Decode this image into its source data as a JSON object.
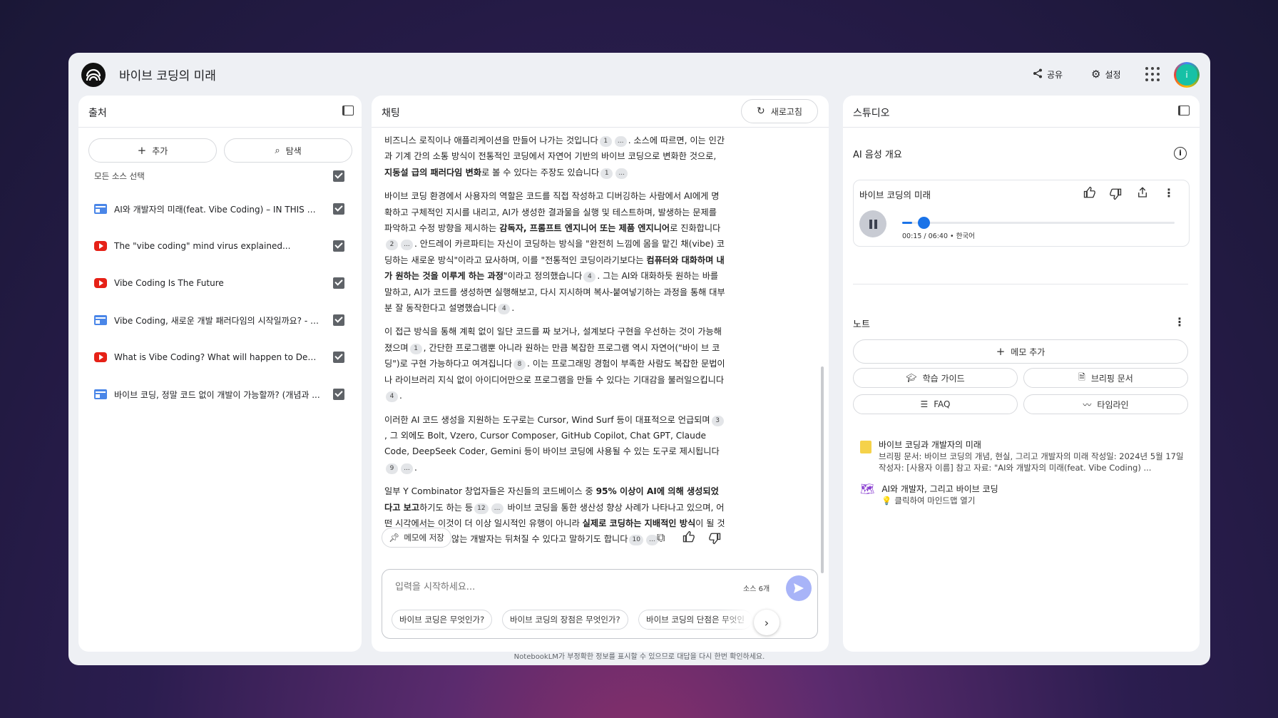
{
  "header": {
    "title": "바이브 코딩의 미래",
    "share": "공유",
    "settings": "설정",
    "avatar_initial": "i"
  },
  "sources": {
    "title": "출처",
    "add": "추가",
    "explore": "탐색",
    "select_all": "모든 소스 선택",
    "items": [
      {
        "label": "AI와 개발자의 미래(feat. Vibe Coding) – IN THIS W...",
        "type": "doc"
      },
      {
        "label": "The \"vibe coding\" mind virus explained...",
        "type": "youtube"
      },
      {
        "label": "Vibe Coding Is The Future",
        "type": "youtube"
      },
      {
        "label": "Vibe Coding, 새로운 개발 패러다임의 시작일까요? - t...",
        "type": "doc"
      },
      {
        "label": "What is Vibe Coding? What will happen to Devel...",
        "type": "youtube"
      },
      {
        "label": "바이브 코딩, 정말 코드 없이 개발이 가능할까? (개념과 ...",
        "type": "doc"
      }
    ]
  },
  "chat": {
    "title": "채팅",
    "refresh": "새로고침",
    "p1": {
      "a": "비즈니스 로직이나 애플리케이션을 만들어 나가는 것입니다",
      "c1": "1",
      "c2": "...",
      "b": ". 소스에 따르면, 이는 인간과 기계 간의 소통 방식이 전통적인 코딩에서 자연어 기반의 바이브 코딩으로 변화한 것으로, ",
      "bold": "지동설 급의 패러다임 변화",
      "d": "로 볼 수 있다는 주장도 있습니다",
      "c3": "1",
      "c4": "..."
    },
    "p2": {
      "a": "바이브 코딩 환경에서 사용자의 역할은 코드를 직접 작성하고 디버깅하는 사람에서 AI에게 명확하고 구체적인 지시를 내리고, AI가 생성한 결과물을 실행 및 테스트하며, 발생하는 문제를 파악하고 수정 방향을 제시하는 ",
      "bold1": "감독자, 프롬프트 엔지니어 또는 제품 엔지니어",
      "b": "로 진화합니다",
      "c1": "2",
      "c2": "...",
      "c": ". 안드레이 카르파티는 자신이 코딩하는 방식을 \"완전히 느낌에 몸을 맡긴 채(vibe) 코딩하는 새로운 방식\"이라고 묘사하며, 이를 \"전통적인 코딩이라기보다는 ",
      "bold2": "컴퓨터와 대화하며 내가 원하는 것을 이루게 하는 과정",
      "d": "\"이라고 정의했습니다",
      "c3": "4",
      "e": ". 그는 AI와 대화하듯 원하는 바를 말하고, AI가 코드를 생성하면 실행해보고, 다시 지시하며 복사-붙여넣기하는 과정을 통해 대부분 잘 동작한다고 설명했습니다",
      "c4": "4"
    },
    "p3": {
      "a": "이 접근 방식을 통해 계획 없이 일단 코드를 짜 보거나, 설계보다 구현을 우선하는 것이 가능해졌으며",
      "c1": "1",
      "b": "간단한 프로그램뿐 아니라 원하는 만큼 복잡한 프로그램 역시 자연어(\"바이 브 코딩\")로 구현 가능하다고 여겨집니다",
      "c2": "8",
      "c": ". 이는 프로그래밍 경험이 부족한 사람도 복잡한 문법이나 라이브러리 지식 없이 아이디어만으로 프로그램을 만들 수 있다는 기대감을 불러일으킵니다",
      "c3": "4"
    },
    "p4": {
      "a": "이러한 AI 코드 생성을 지원하는 도구로는 Cursor, Wind Surf 등이 대표적으로 언급되며",
      "c1": "3",
      "b": ", 그 외에도 Bolt, Vzero, Cursor Composer, GitHub Copilot, Chat GPT, Claude Code, DeepSeek Coder, Gemini 등이 바이브 코딩에 사용될 수 있는 도구로 제시됩니다",
      "c2": "9",
      "c3": "..."
    },
    "p5": {
      "a": "일부 Y Combinator 창업자들은 자신들의 코드베이스 중 ",
      "bold1": "95% 이상이 AI에 의해 생성되었다고 보고",
      "b": "하기도 하는 등",
      "c1": "12",
      "c2": "...",
      "c": " 바이브 코딩을 통한 생산성 향상 사례가 나타나고 있으며, 어떤 시각에서는 이것이 더 이상 일시적인 유행이 아니라 ",
      "bold2": "실제로 코딩하는 지배적인 방식",
      "d": "이 될 것이며, 이를 따르지 않는 개발자는 뒤처질 수 있다고 말하기도 합니다",
      "c3": "10",
      "c4": "...",
      "e": "."
    },
    "save_memo": "메모에 저장",
    "input_placeholder": "입력을 시작하세요...",
    "source_count": "소스 6개",
    "suggestions": [
      "바이브 코딩은 무엇인가?",
      "바이브 코딩의 장점은 무엇인가?",
      "바이브 코딩의 단점은 무엇인"
    ]
  },
  "studio": {
    "title": "스튜디오",
    "audio_overview": "AI 음성 개요",
    "audio": {
      "title": "바이브 코딩의 미래",
      "time": "00:15 / 06:40 • 한국어",
      "progress": 0.0375
    },
    "notes_title": "노트",
    "add_memo": "메모 추가",
    "buttons": [
      "학습 가이드",
      "브리핑 문서",
      "FAQ",
      "타임라인"
    ],
    "notes": [
      {
        "title": "바이브 코딩과 개발자의 미래",
        "body": "브리핑 문서: 바이브 코딩의 개념, 현실, 그리고 개발자의 미래 작성일: 2024년 5월 17일 작성자: [사용자 이름] 참고 자료: \"AI와 개발자의 미래(feat. Vibe Coding) ..."
      },
      {
        "title": "AI와 개발자, 그리고 바이브 코딩",
        "body": "💡 클릭하여 마인드맵 열기"
      }
    ]
  },
  "footer": "NotebookLM가 부정확한 정보를 표시할 수 있으므로 대답을 다시 한번 확인하세요."
}
